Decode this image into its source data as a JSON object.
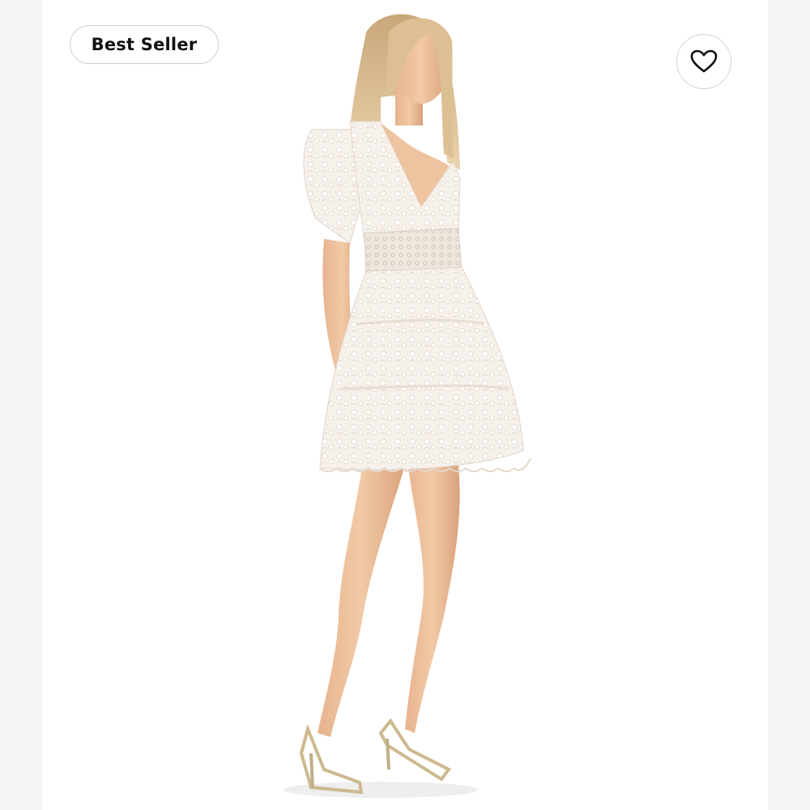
{
  "badge": {
    "label": "Best Seller"
  },
  "actions": {
    "like_icon": "heart-outline-icon"
  },
  "product_image": {
    "subject": "model-in-white-lace-mini-dress"
  }
}
